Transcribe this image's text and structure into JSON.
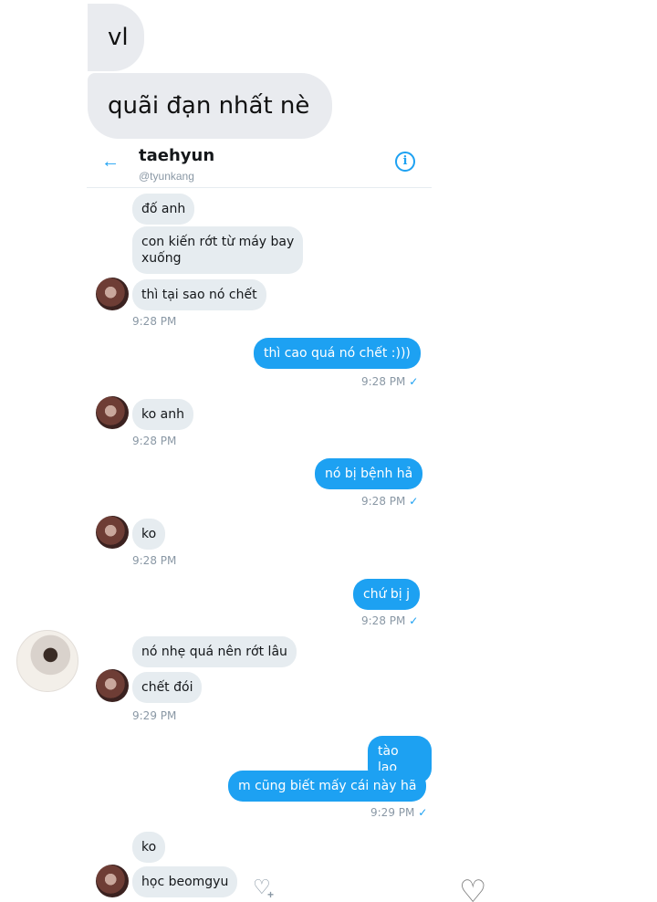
{
  "outer_messages": [
    "vl",
    "quãi đạn nhất nè"
  ],
  "screenshot": {
    "header": {
      "name": "taehyun",
      "handle": "@tyunkang"
    },
    "messages": {
      "m1": "đố anh",
      "m2_line1": "con kiến rớt từ máy bay",
      "m2_line2": "xuống",
      "m3": "thì tại sao nó chết",
      "t1": "9:28 PM",
      "s1": "thì cao quá nó chết :)))",
      "t2": "9:28 PM",
      "m4": "ko anh",
      "t3": "9:28 PM",
      "s2": "nó bị bệnh hả",
      "t4": "9:28 PM",
      "m5": "ko",
      "t5": "9:28 PM",
      "s3": "chứ bị j",
      "t6": "9:28 PM",
      "m6": "nó nhẹ quá nên rớt lâu",
      "m7": "chết đói",
      "t7": "9:29 PM",
      "s4": "tào lao",
      "s5": "m cũng biết mấy cái này hã",
      "t8": "9:29 PM",
      "m8": "ko",
      "m9": "học beomgyu"
    }
  },
  "colors": {
    "accent": "#1da1f2",
    "received_bubble": "#e6ecf0",
    "outer_bubble": "#e9ebef"
  },
  "icons": [
    "back-arrow-icon",
    "info-icon",
    "check-icon",
    "heart-add-icon",
    "heart-icon"
  ]
}
